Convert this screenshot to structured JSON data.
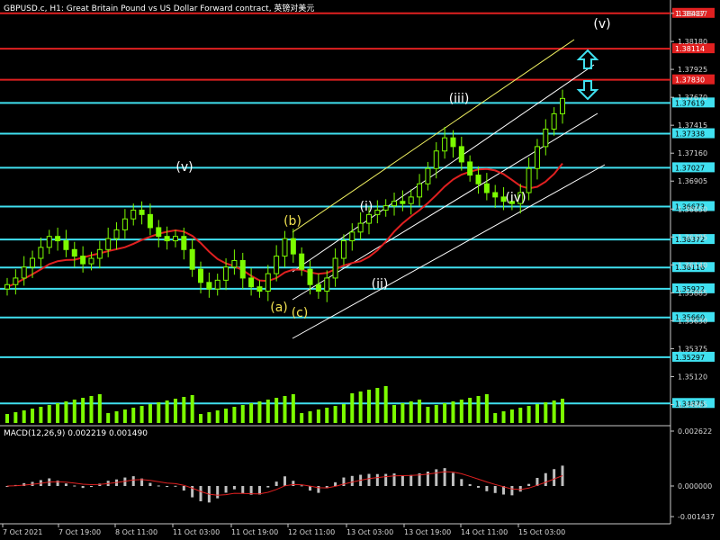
{
  "header": {
    "title": "GBPUSD.c, H1:  Great Britain Pound vs US Dollar Forward contract, 英镑对美元"
  },
  "macd": {
    "label": "MACD(12,26,9) 0.002219 0.001490",
    "scale": [
      "0.002622",
      "0.000000",
      "-0.001437"
    ]
  },
  "colors": {
    "background": "#000000",
    "candle": "#7cfc00",
    "support_line": "#40e0f0",
    "resistance_line": "#e02020",
    "ma_line": "#e02020",
    "upper_channel": "#f0f060",
    "channel": "#ffffff",
    "arrow": "#40e0f0",
    "wave_yellow": "#f0e050",
    "wave_white": "#ffffff",
    "volume": "#7cfc00",
    "macd_hist": "#c0c0c0",
    "macd_signal": "#e02020"
  },
  "price_scale": [
    "1.38437",
    "1.38180",
    "1.37925",
    "1.37670",
    "1.37415",
    "1.37160",
    "1.36905",
    "1.36650",
    "1.36395",
    "1.36140",
    "1.35885",
    "1.35630",
    "1.35375",
    "1.35120",
    "1.34865"
  ],
  "levels": [
    {
      "label": "1.38437",
      "kind": "resistance"
    },
    {
      "label": "1.38114",
      "kind": "resistance"
    },
    {
      "label": "1.37830",
      "kind": "resistance"
    },
    {
      "label": "1.37619",
      "kind": "support"
    },
    {
      "label": "1.37338",
      "kind": "support"
    },
    {
      "label": "1.37027",
      "kind": "support"
    },
    {
      "label": "1.36673",
      "kind": "support"
    },
    {
      "label": "1.36372",
      "kind": "support"
    },
    {
      "label": "1.36116",
      "kind": "support"
    },
    {
      "label": "1.35922",
      "kind": "support"
    },
    {
      "label": "1.35660",
      "kind": "support"
    },
    {
      "label": "1.35297",
      "kind": "support"
    },
    {
      "label": "1.34875",
      "kind": "support"
    }
  ],
  "time_axis": [
    "7 Oct 2021",
    "7 Oct 19:00",
    "8 Oct 11:00",
    "11 Oct 03:00",
    "11 Oct 19:00",
    "12 Oct 11:00",
    "13 Oct 03:00",
    "13 Oct 19:00",
    "14 Oct 11:00",
    "15 Oct 03:00"
  ],
  "waves": [
    {
      "label": "(v)",
      "color": "white"
    },
    {
      "label": "(b)",
      "color": "yellow"
    },
    {
      "label": "(a)",
      "color": "yellow"
    },
    {
      "label": "(c)",
      "color": "yellow"
    },
    {
      "label": "(i)",
      "color": "white"
    },
    {
      "label": "(ii)",
      "color": "white"
    },
    {
      "label": "(iii)",
      "color": "white"
    },
    {
      "label": "(iv)",
      "color": "white"
    },
    {
      "label": "(v)",
      "color": "white"
    }
  ],
  "chart_data": {
    "type": "candlestick",
    "series": [
      {
        "name": "GBPUSD.c",
        "close": [
          1.3596,
          1.3602,
          1.3612,
          1.362,
          1.363,
          1.364,
          1.3636,
          1.3628,
          1.3622,
          1.3615,
          1.362,
          1.3628,
          1.3638,
          1.3646,
          1.3656,
          1.3664,
          1.366,
          1.3648,
          1.364,
          1.3636,
          1.364,
          1.3628,
          1.361,
          1.3598,
          1.3592,
          1.36,
          1.3612,
          1.3618,
          1.3602,
          1.3594,
          1.359,
          1.3606,
          1.3622,
          1.3638,
          1.3624,
          1.361,
          1.3596,
          1.359,
          1.3602,
          1.362,
          1.3636,
          1.3644,
          1.3652,
          1.366,
          1.3664,
          1.3668,
          1.3672,
          1.367,
          1.3676,
          1.3688,
          1.3702,
          1.3718,
          1.373,
          1.3722,
          1.3708,
          1.3696,
          1.3688,
          1.368,
          1.3676,
          1.3672,
          1.367,
          1.368,
          1.3702,
          1.3722,
          1.3738,
          1.3752,
          1.3766
        ]
      }
    ]
  }
}
